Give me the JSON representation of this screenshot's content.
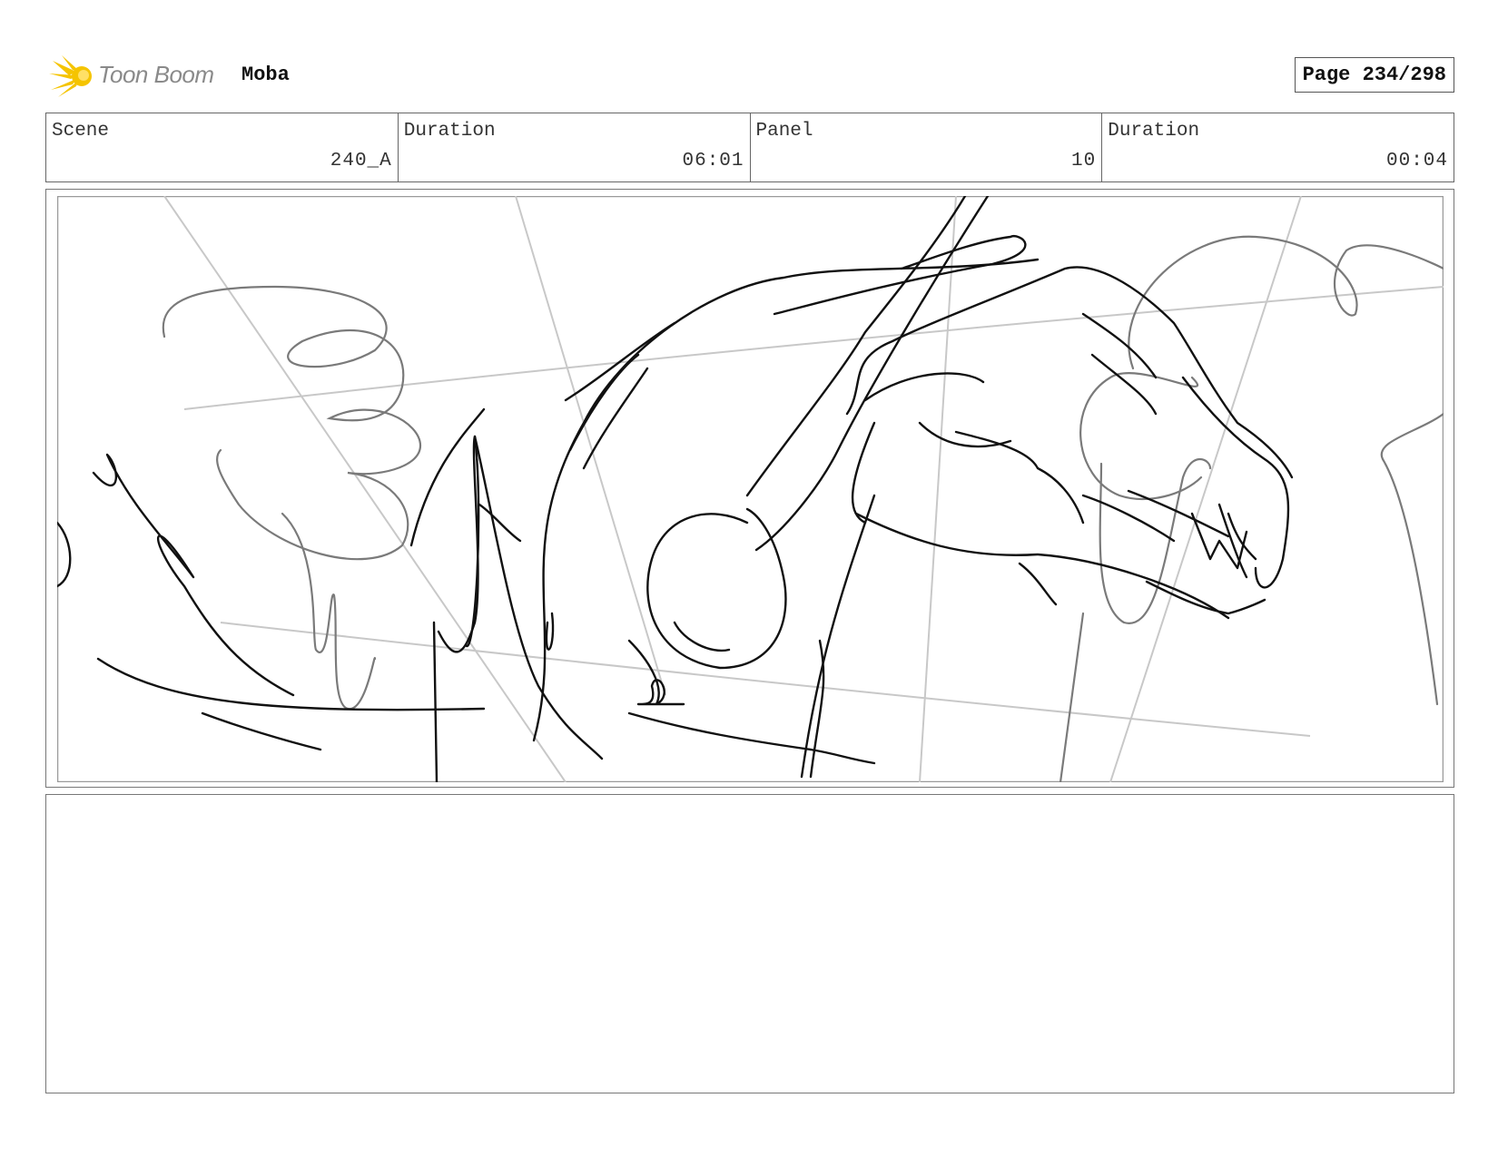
{
  "header": {
    "logo_text": "Toon Boom",
    "project_name": "Moba",
    "page_label": "Page 234/298"
  },
  "info": {
    "scene_label": "Scene",
    "scene_value": "240_A",
    "scene_duration_label": "Duration",
    "scene_duration_value": "06:01",
    "panel_label": "Panel",
    "panel_value": "10",
    "panel_duration_label": "Duration",
    "panel_duration_value": "00:04"
  },
  "colors": {
    "logo_accent": "#f5c400",
    "ink": "#111111",
    "sketch_gray": "#7a7a7a",
    "guide_gray": "#c8c8c8"
  },
  "icons": {
    "logo": "toon-boom-logo-icon"
  }
}
